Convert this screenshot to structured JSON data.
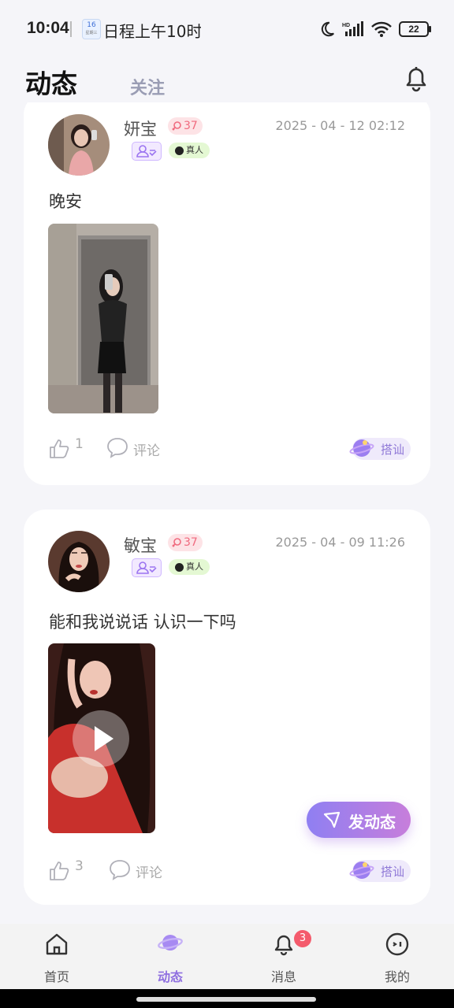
{
  "status_bar": {
    "time": "10:04",
    "calendar_day": "16",
    "calendar_sub": "星期三",
    "notification": "日程上午10时",
    "battery": "22",
    "icons": [
      "moon-icon",
      "signal-icon",
      "wifi-icon",
      "battery-icon"
    ]
  },
  "header": {
    "tab_main": "动态",
    "tab_follow": "关注",
    "icon": "bell-icon"
  },
  "posts": [
    {
      "name": "妍宝",
      "age": "37",
      "real_tag": "真人",
      "time": "2025 - 04 - 12 02:12",
      "text": "晚安",
      "media": "photo",
      "likes": "1",
      "comment_label": "评论",
      "chat_label": "搭讪"
    },
    {
      "name": "敏宝",
      "age": "37",
      "real_tag": "真人",
      "time": "2025 - 04 - 09 11:26",
      "text": "能和我说说话 认识一下吗",
      "media": "video",
      "likes": "3",
      "comment_label": "评论",
      "chat_label": "搭讪"
    }
  ],
  "fab": {
    "label": "发动态"
  },
  "nav": {
    "items": [
      {
        "label": "首页",
        "icon": "home-icon"
      },
      {
        "label": "动态",
        "icon": "planet-icon",
        "active": true
      },
      {
        "label": "消息",
        "icon": "bell-icon",
        "badge": "3"
      },
      {
        "label": "我的",
        "icon": "face-icon"
      }
    ]
  },
  "colors": {
    "accent": "#8f6fe0",
    "background": "#f5f5f9",
    "badge": "#f45b6c"
  }
}
